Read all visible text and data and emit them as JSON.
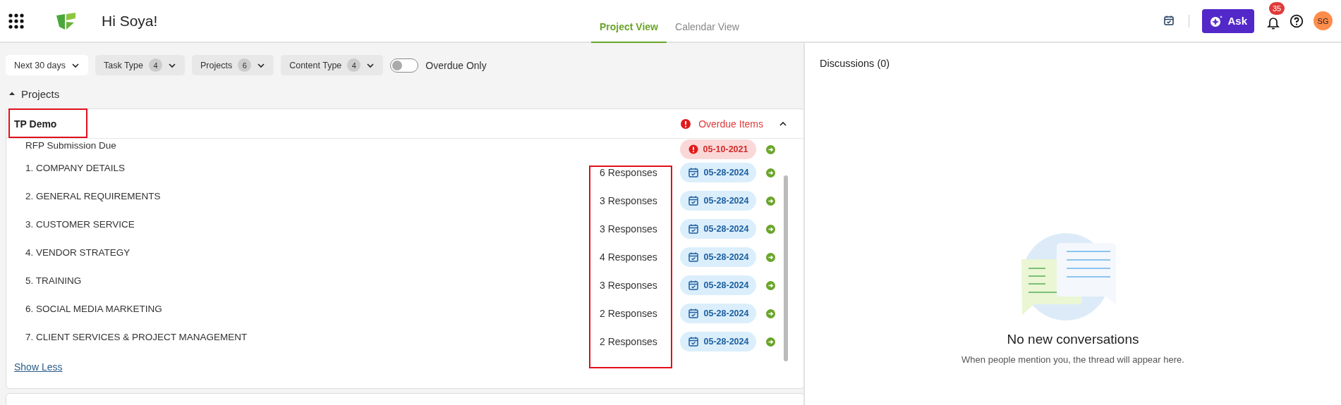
{
  "header": {
    "greeting": "Hi Soya!",
    "tabs": [
      {
        "label": "Project View",
        "selected": true
      },
      {
        "label": "Calendar View",
        "selected": false
      }
    ],
    "ask_button": "Ask",
    "notification_count": "35",
    "avatar": "SG"
  },
  "filters": [
    {
      "label": "Next 30 days",
      "selected": true
    },
    {
      "label": "Task Type",
      "count": "4",
      "selected": false
    },
    {
      "label": "Projects",
      "count": "6",
      "selected": false
    },
    {
      "label": "Content Type",
      "count": "4",
      "selected": false
    }
  ],
  "overdue_toggle": {
    "label": "Overdue Only",
    "on": false
  },
  "section": {
    "title": "Projects",
    "expanded": true
  },
  "project": {
    "name": "TP Demo",
    "overdue_label": "Overdue Items",
    "expanded": true,
    "show_less": "Show Less",
    "items": [
      {
        "title": "RFP Submission Due",
        "date": "05-10-2021",
        "overdue": true
      },
      {
        "title": "1. COMPANY DETAILS",
        "responses": "6 Responses",
        "date": "05-28-2024",
        "overdue": false
      },
      {
        "title": "2. GENERAL REQUIREMENTS",
        "responses": "3 Responses",
        "date": "05-28-2024",
        "overdue": false
      },
      {
        "title": "3. CUSTOMER SERVICE",
        "responses": "3 Responses",
        "date": "05-28-2024",
        "overdue": false
      },
      {
        "title": "4. VENDOR STRATEGY",
        "responses": "4 Responses",
        "date": "05-28-2024",
        "overdue": false
      },
      {
        "title": "5. TRAINING",
        "responses": "3 Responses",
        "date": "05-28-2024",
        "overdue": false
      },
      {
        "title": "6. SOCIAL MEDIA MARKETING",
        "responses": "2 Responses",
        "date": "05-28-2024",
        "overdue": false
      },
      {
        "title": "7. CLIENT SERVICES & PROJECT MANAGEMENT",
        "responses": "2 Responses",
        "date": "05-28-2024",
        "overdue": false
      }
    ]
  },
  "discussions": {
    "title": "Discussions (0)",
    "empty_title": "No new conversations",
    "empty_text": "When people mention you, the thread will appear here."
  }
}
